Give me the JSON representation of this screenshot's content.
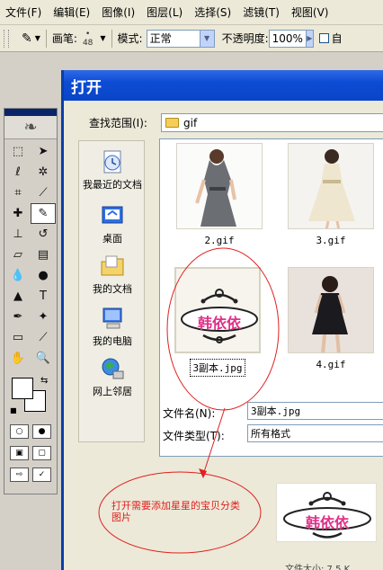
{
  "menu": [
    "文件(F)",
    "编辑(E)",
    "图像(I)",
    "图层(L)",
    "选择(S)",
    "滤镜(T)",
    "视图(V)"
  ],
  "options": {
    "brush_label": "画笔:",
    "brush_size": "48",
    "mode_label": "模式:",
    "mode_value": "正常",
    "opacity_label": "不透明度:",
    "opacity_value": "100%",
    "auto_label": "自"
  },
  "dialog": {
    "title": "打开",
    "lookin_label": "查找范围(I):",
    "lookin_value": "gif",
    "places": [
      "我最近的文档",
      "桌面",
      "我的文档",
      "我的电脑",
      "网上邻居"
    ],
    "files": [
      {
        "name": "2.gif",
        "kind": "photo-gray-dress"
      },
      {
        "name": "3.gif",
        "kind": "photo-white-dress"
      },
      {
        "name": "3副本.jpg",
        "kind": "logo",
        "selected": true
      },
      {
        "name": "4.gif",
        "kind": "photo-black-dress"
      }
    ],
    "filename_label": "文件名(N):",
    "filename_value": "3副本.jpg",
    "filetype_label": "文件类型(T):",
    "filetype_value": "所有格式",
    "size_text": "文件大小: 7.5 K"
  },
  "logo_text": "韩依依",
  "annotation": "打开需要添加星星的宝贝分类图片",
  "colors": {
    "accent": "#0c4cd4",
    "annotation": "#e02020",
    "logo_pink": "#e0328a"
  }
}
